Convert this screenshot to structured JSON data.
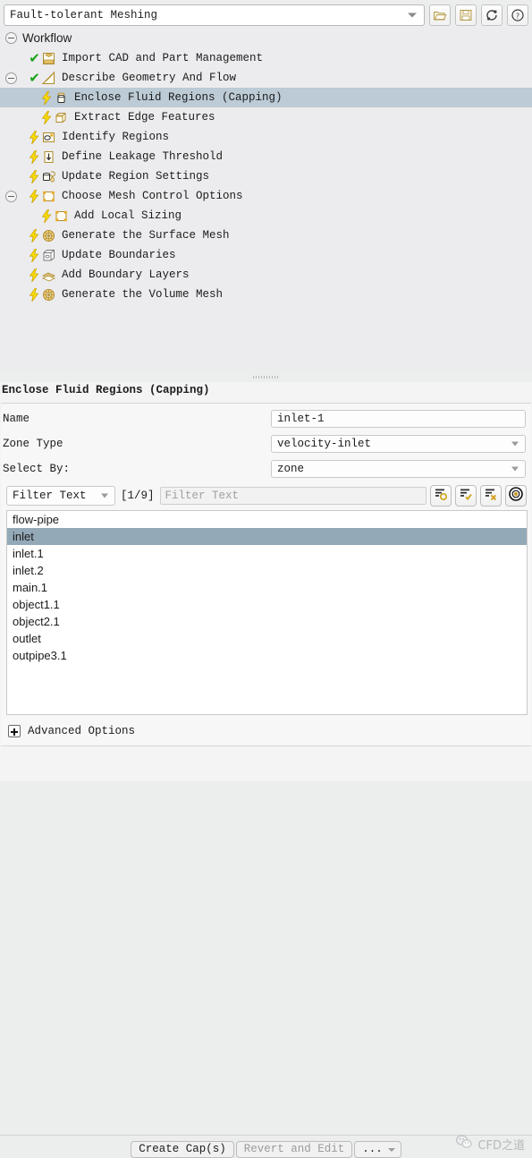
{
  "topbar": {
    "workflow_name": "Fault-tolerant Meshing",
    "buttons": [
      {
        "name": "open-workflow-button",
        "icon": "folder-open-icon"
      },
      {
        "name": "save-workflow-button",
        "icon": "save-icon"
      },
      {
        "name": "reset-workflow-button",
        "icon": "refresh-icon"
      },
      {
        "name": "help-button",
        "icon": "help-icon"
      }
    ]
  },
  "tree": {
    "root_label": "Workflow",
    "items": [
      {
        "label": "Import CAD and Part Management",
        "indent": 1,
        "state": "done",
        "icon": "cad-import-icon",
        "expander": false,
        "selected": false
      },
      {
        "label": "Describe Geometry And Flow",
        "indent": 1,
        "state": "done",
        "icon": "geometry-icon",
        "expander": true,
        "selected": false
      },
      {
        "label": "Enclose Fluid Regions (Capping)",
        "indent": 2,
        "state": "pending",
        "icon": "capping-icon",
        "expander": false,
        "selected": true
      },
      {
        "label": "Extract Edge Features",
        "indent": 2,
        "state": "pending",
        "icon": "edge-features-icon",
        "expander": false,
        "selected": false
      },
      {
        "label": "Identify Regions",
        "indent": 1,
        "state": "pending",
        "icon": "identify-regions-icon",
        "expander": false,
        "selected": false
      },
      {
        "label": "Define Leakage Threshold",
        "indent": 1,
        "state": "pending",
        "icon": "leakage-icon",
        "expander": false,
        "selected": false
      },
      {
        "label": "Update Region Settings",
        "indent": 1,
        "state": "pending",
        "icon": "region-settings-icon",
        "expander": false,
        "selected": false
      },
      {
        "label": "Choose Mesh Control Options",
        "indent": 1,
        "state": "pending",
        "icon": "mesh-control-icon",
        "expander": true,
        "selected": false
      },
      {
        "label": "Add Local Sizing",
        "indent": 2,
        "state": "pending",
        "icon": "local-sizing-icon",
        "expander": false,
        "selected": false
      },
      {
        "label": "Generate the Surface Mesh",
        "indent": 1,
        "state": "pending",
        "icon": "surface-mesh-icon",
        "expander": false,
        "selected": false
      },
      {
        "label": "Update Boundaries",
        "indent": 1,
        "state": "pending",
        "icon": "boundaries-icon",
        "expander": false,
        "selected": false
      },
      {
        "label": "Add Boundary Layers",
        "indent": 1,
        "state": "pending",
        "icon": "boundary-layers-icon",
        "expander": false,
        "selected": false
      },
      {
        "label": "Generate the Volume Mesh",
        "indent": 1,
        "state": "pending",
        "icon": "volume-mesh-icon",
        "expander": false,
        "selected": false
      }
    ]
  },
  "panel": {
    "title": "Enclose Fluid Regions (Capping)",
    "fields": [
      {
        "label": "Name",
        "value": "inlet-1",
        "type": "text"
      },
      {
        "label": "Zone Type",
        "value": "velocity-inlet",
        "type": "dropdown"
      },
      {
        "label": "Select By:",
        "value": "zone",
        "type": "dropdown"
      }
    ],
    "filter": {
      "mode": "Filter Text",
      "counter": "[1/9]",
      "placeholder": "Filter Text",
      "buttons": [
        {
          "name": "list-all-button",
          "icon": "list-circle-icon"
        },
        {
          "name": "select-all-button",
          "icon": "list-check-icon"
        },
        {
          "name": "deselect-all-button",
          "icon": "list-x-icon"
        },
        {
          "name": "pick-from-graphics-button",
          "icon": "target-icon"
        }
      ]
    },
    "list": [
      {
        "label": "flow-pipe",
        "selected": false
      },
      {
        "label": "inlet",
        "selected": true
      },
      {
        "label": "inlet.1",
        "selected": false
      },
      {
        "label": "inlet.2",
        "selected": false
      },
      {
        "label": "main.1",
        "selected": false
      },
      {
        "label": "object1.1",
        "selected": false
      },
      {
        "label": "object2.1",
        "selected": false
      },
      {
        "label": "outlet",
        "selected": false
      },
      {
        "label": "outpipe3.1",
        "selected": false
      }
    ],
    "advanced_options_label": "Advanced Options"
  },
  "actions": {
    "primary": "Create Cap(s)",
    "secondary": "Revert and Edit",
    "more": "..."
  },
  "watermark": {
    "text": "CFD之道"
  },
  "colors": {
    "selection_tree": "#bccbd6",
    "selection_list": "#94a9b8",
    "bolt_yellow": "#ffe000",
    "check_green": "#19a219",
    "panel_bg": "#f4f4f4",
    "tree_bg": "#ececee"
  }
}
